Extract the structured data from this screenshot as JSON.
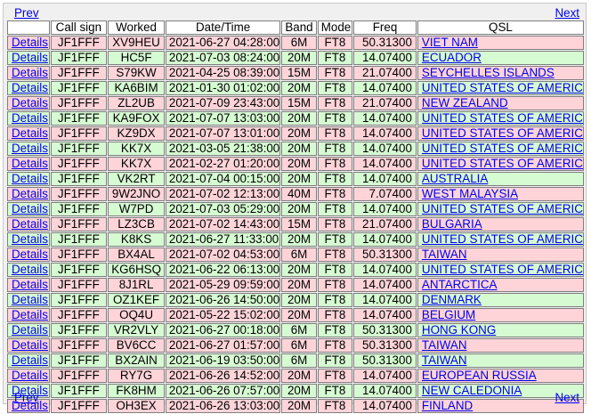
{
  "nav": {
    "prev_label": "Prev",
    "next_label": "Next"
  },
  "columns": [
    "",
    "Call sign",
    "Worked",
    "Date/Time",
    "Band",
    "Mode",
    "Freq",
    "QSL"
  ],
  "rows": [
    {
      "details": "Details",
      "call": "JF1FFF",
      "worked": "XV9HEU",
      "datetime": "2021-06-27 04:28:00",
      "band": "6M",
      "mode": "FT8",
      "freq": "50.31300",
      "qsl": "VIET NAM",
      "status": "unconfirmed"
    },
    {
      "details": "Details",
      "call": "JF1FFF",
      "worked": "HC5F",
      "datetime": "2021-07-03 08:24:00",
      "band": "20M",
      "mode": "FT8",
      "freq": "14.07400",
      "qsl": "ECUADOR",
      "status": "confirmed"
    },
    {
      "details": "Details",
      "call": "JF1FFF",
      "worked": "S79KW",
      "datetime": "2021-04-25 08:39:00",
      "band": "15M",
      "mode": "FT8",
      "freq": "21.07400",
      "qsl": "SEYCHELLES ISLANDS",
      "status": "unconfirmed"
    },
    {
      "details": "Details",
      "call": "JF1FFF",
      "worked": "KA6BIM",
      "datetime": "2021-01-30 01:02:00",
      "band": "20M",
      "mode": "FT8",
      "freq": "14.07400",
      "qsl": "UNITED STATES OF AMERICA",
      "status": "confirmed"
    },
    {
      "details": "Details",
      "call": "JF1FFF",
      "worked": "ZL2UB",
      "datetime": "2021-07-09 23:43:00",
      "band": "15M",
      "mode": "FT8",
      "freq": "21.07400",
      "qsl": "NEW ZEALAND",
      "status": "unconfirmed"
    },
    {
      "details": "Details",
      "call": "JF1FFF",
      "worked": "KA9FOX",
      "datetime": "2021-07-07 13:03:00",
      "band": "20M",
      "mode": "FT8",
      "freq": "14.07400",
      "qsl": "UNITED STATES OF AMERICA",
      "status": "confirmed"
    },
    {
      "details": "Details",
      "call": "JF1FFF",
      "worked": "KZ9DX",
      "datetime": "2021-07-07 13:01:00",
      "band": "20M",
      "mode": "FT8",
      "freq": "14.07400",
      "qsl": "UNITED STATES OF AMERICA",
      "status": "unconfirmed"
    },
    {
      "details": "Details",
      "call": "JF1FFF",
      "worked": "KK7X",
      "datetime": "2021-03-05 21:38:00",
      "band": "20M",
      "mode": "FT8",
      "freq": "14.07400",
      "qsl": "UNITED STATES OF AMERICA",
      "status": "confirmed"
    },
    {
      "details": "Details",
      "call": "JF1FFF",
      "worked": "KK7X",
      "datetime": "2021-02-27 01:20:00",
      "band": "20M",
      "mode": "FT8",
      "freq": "14.07400",
      "qsl": "UNITED STATES OF AMERICA",
      "status": "unconfirmed"
    },
    {
      "details": "Details",
      "call": "JF1FFF",
      "worked": "VK2RT",
      "datetime": "2021-07-04 00:15:00",
      "band": "20M",
      "mode": "FT8",
      "freq": "14.07400",
      "qsl": "AUSTRALIA",
      "status": "confirmed"
    },
    {
      "details": "Details",
      "call": "JF1FFF",
      "worked": "9W2JNO",
      "datetime": "2021-07-02 12:13:00",
      "band": "40M",
      "mode": "FT8",
      "freq": "7.07400",
      "qsl": "WEST MALAYSIA",
      "status": "unconfirmed"
    },
    {
      "details": "Details",
      "call": "JF1FFF",
      "worked": "W7PD",
      "datetime": "2021-07-03 05:29:00",
      "band": "20M",
      "mode": "FT8",
      "freq": "14.07400",
      "qsl": "UNITED STATES OF AMERICA",
      "status": "confirmed"
    },
    {
      "details": "Details",
      "call": "JF1FFF",
      "worked": "LZ3CB",
      "datetime": "2021-07-02 14:43:00",
      "band": "15M",
      "mode": "FT8",
      "freq": "21.07400",
      "qsl": "BULGARIA",
      "status": "unconfirmed"
    },
    {
      "details": "Details",
      "call": "JF1FFF",
      "worked": "K8KS",
      "datetime": "2021-06-27 11:33:00",
      "band": "20M",
      "mode": "FT8",
      "freq": "14.07400",
      "qsl": "UNITED STATES OF AMERICA",
      "status": "confirmed"
    },
    {
      "details": "Details",
      "call": "JF1FFF",
      "worked": "BX4AL",
      "datetime": "2021-07-02 04:53:00",
      "band": "6M",
      "mode": "FT8",
      "freq": "50.31300",
      "qsl": "TAIWAN",
      "status": "unconfirmed"
    },
    {
      "details": "Details",
      "call": "JF1FFF",
      "worked": "KG6HSQ",
      "datetime": "2021-06-22 06:13:00",
      "band": "20M",
      "mode": "FT8",
      "freq": "14.07400",
      "qsl": "UNITED STATES OF AMERICA",
      "status": "confirmed"
    },
    {
      "details": "Details",
      "call": "JF1FFF",
      "worked": "8J1RL",
      "datetime": "2021-05-29 09:59:00",
      "band": "20M",
      "mode": "FT8",
      "freq": "14.07400",
      "qsl": "ANTARCTICA",
      "status": "unconfirmed"
    },
    {
      "details": "Details",
      "call": "JF1FFF",
      "worked": "OZ1KEF",
      "datetime": "2021-06-26 14:50:00",
      "band": "20M",
      "mode": "FT8",
      "freq": "14.07400",
      "qsl": "DENMARK",
      "status": "confirmed"
    },
    {
      "details": "Details",
      "call": "JF1FFF",
      "worked": "OQ4U",
      "datetime": "2021-05-22 15:02:00",
      "band": "20M",
      "mode": "FT8",
      "freq": "14.07400",
      "qsl": "BELGIUM",
      "status": "unconfirmed"
    },
    {
      "details": "Details",
      "call": "JF1FFF",
      "worked": "VR2VLY",
      "datetime": "2021-06-27 00:18:00",
      "band": "6M",
      "mode": "FT8",
      "freq": "50.31300",
      "qsl": "HONG KONG",
      "status": "confirmed"
    },
    {
      "details": "Details",
      "call": "JF1FFF",
      "worked": "BV6CC",
      "datetime": "2021-06-27 01:57:00",
      "band": "6M",
      "mode": "FT8",
      "freq": "50.31300",
      "qsl": "TAIWAN",
      "status": "unconfirmed"
    },
    {
      "details": "Details",
      "call": "JF1FFF",
      "worked": "BX2AIN",
      "datetime": "2021-06-19 03:50:00",
      "band": "6M",
      "mode": "FT8",
      "freq": "50.31300",
      "qsl": "TAIWAN",
      "status": "confirmed"
    },
    {
      "details": "Details",
      "call": "JF1FFF",
      "worked": "RY7G",
      "datetime": "2021-06-26 14:52:00",
      "band": "20M",
      "mode": "FT8",
      "freq": "14.07400",
      "qsl": "EUROPEAN RUSSIA",
      "status": "unconfirmed"
    },
    {
      "details": "Details",
      "call": "JF1FFF",
      "worked": "FK8HM",
      "datetime": "2021-06-26 07:57:00",
      "band": "20M",
      "mode": "FT8",
      "freq": "14.07400",
      "qsl": "NEW CALEDONIA",
      "status": "confirmed"
    },
    {
      "details": "Details",
      "call": "JF1FFF",
      "worked": "OH3EX",
      "datetime": "2021-06-26 13:03:00",
      "band": "20M",
      "mode": "FT8",
      "freq": "14.07400",
      "qsl": "FINLAND",
      "status": "unconfirmed"
    }
  ],
  "colors": {
    "unconfirmed_row": "#ffd4d9",
    "confirmed_row": "#d6fbd2",
    "link": "#0000ee",
    "panel": "#f0f0f0",
    "cell_border": "#7f7f7f"
  }
}
